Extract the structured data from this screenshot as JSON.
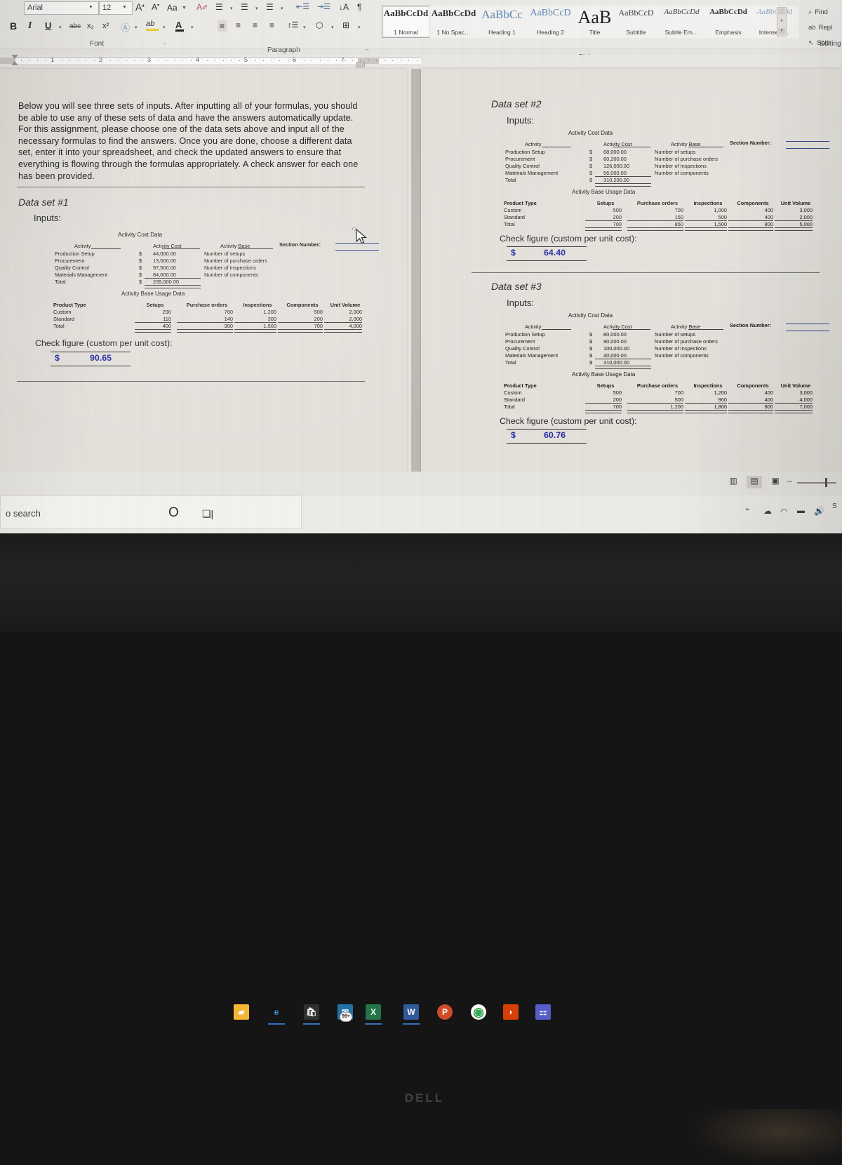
{
  "window": {
    "app": "Microsoft Word",
    "font_name": "Arial",
    "font_size": "12"
  },
  "ribbon": {
    "groups": {
      "font": "Font",
      "paragraph": "Paragraph",
      "styles": "Styles",
      "editing": "Editing"
    },
    "font_buttons": {
      "grow": "A",
      "shrink": "A",
      "change_case": "Aa",
      "clear_formatting": "clear-formatting-icon",
      "bold": "B",
      "italic": "I",
      "underline": "U",
      "strikethrough": "abc",
      "subscript": "x₂",
      "superscript": "x²",
      "text_effects": "A",
      "highlight": "ab",
      "font_color": "A"
    },
    "paragraph_buttons": [
      "bullets-icon",
      "numbering-icon",
      "multilevel-list-icon",
      "decrease-indent-icon",
      "increase-indent-icon",
      "sort-icon",
      "show-marks-icon",
      "align-left-icon",
      "align-center-icon",
      "align-right-icon",
      "justify-icon",
      "line-spacing-icon",
      "shading-icon",
      "borders-icon"
    ],
    "styles": [
      {
        "preview": "AaBbCcDd",
        "name": "1 Normal",
        "size": 13,
        "color": "#2c2c2c",
        "bold": true,
        "selected": true
      },
      {
        "preview": "AaBbCcDd",
        "name": "1 No Spac…",
        "size": 13,
        "color": "#2c2c2c",
        "bold": true,
        "selected": false
      },
      {
        "preview": "AaBbCc",
        "name": "Heading 1",
        "size": 17,
        "color": "#5b86b5",
        "bold": false,
        "selected": false
      },
      {
        "preview": "AaBbCcD",
        "name": "Heading 2",
        "size": 14,
        "color": "#5b86b5",
        "bold": false,
        "selected": false
      },
      {
        "preview": "AaB",
        "name": "Title",
        "size": 26,
        "color": "#1b1b1b",
        "bold": false,
        "selected": false
      },
      {
        "preview": "AaBbCcD",
        "name": "Subtitle",
        "size": 12,
        "color": "#3c3c3c",
        "bold": false,
        "selected": false
      },
      {
        "preview": "AaBbCcDd",
        "name": "Subtle Em…",
        "size": 11,
        "color": "#3c3c3c",
        "bold": false,
        "selected": false
      },
      {
        "preview": "AaBbCcDd",
        "name": "Emphasis",
        "size": 11,
        "color": "#2c2c2c",
        "bold": true,
        "selected": false
      },
      {
        "preview": "AaBbCcDd",
        "name": "Intense E…",
        "size": 11,
        "color": "#8fa8c2",
        "bold": false,
        "selected": false
      }
    ],
    "editing": [
      {
        "icon": "search-icon",
        "label": "Find"
      },
      {
        "icon": "replace-icon",
        "label": "Repl"
      },
      {
        "icon": "select-icon",
        "label": "Sele"
      }
    ]
  },
  "ruler": {
    "ticks": [
      "1",
      "2",
      "3",
      "4",
      "5",
      "6",
      "7"
    ]
  },
  "document": {
    "intro_paragraph": "Below you will see three sets of inputs.  After inputting all of your formulas, you should be able to use any of these sets of data and have the answers automatically update. For this assignment, please choose one of the data sets above and input all of the necessary formulas to find the answers. Once you are done, choose a different data set, enter it into your spreadsheet, and check the updated answers to ensure that everything is flowing through the formulas appropriately. A check answer for each one has been provided.",
    "inputs_label": "Inputs:",
    "section_number_label": "Section Number:",
    "check_figure_label": "Check figure (custom per unit cost):",
    "dollar_sign": "$",
    "cost_table": {
      "title": "Activity Cost Data",
      "columns": [
        "Activity",
        "Activity Cost",
        "Activity Base"
      ],
      "total_label": "Total"
    },
    "usage_table": {
      "title": "Activity Base Usage Data",
      "columns": [
        "Product Type",
        "Setups",
        "Purchase orders",
        "Inspections",
        "Components",
        "Unit Volume"
      ],
      "rows_labels": [
        "Custom",
        "Standard",
        "Total"
      ]
    },
    "data_sets": [
      {
        "title": "Data set #1",
        "cost_rows": [
          {
            "activity": "Production Setup",
            "cost": "44,000.00",
            "base": "Number of setups"
          },
          {
            "activity": "Procurement",
            "cost": "13,500.00",
            "base": "Number of purchase orders"
          },
          {
            "activity": "Quality Control",
            "cost": "97,500.00",
            "base": "Number of Inspections"
          },
          {
            "activity": "Materials Management",
            "cost": "84,000.00",
            "base": "Number of components"
          }
        ],
        "cost_total": "239,000.00",
        "usage_rows": [
          {
            "type": "Custom",
            "setups": "290",
            "purchase_orders": "760",
            "inspections": "1,200",
            "components": "500",
            "unit_volume": "2,000"
          },
          {
            "type": "Standard",
            "setups": "110",
            "purchase_orders": "140",
            "inspections": "300",
            "components": "200",
            "unit_volume": "2,000"
          },
          {
            "type": "Total",
            "setups": "400",
            "purchase_orders": "900",
            "inspections": "1,500",
            "components": "700",
            "unit_volume": "4,000"
          }
        ],
        "check_figure": "90.65"
      },
      {
        "title": "Data set #2",
        "cost_rows": [
          {
            "activity": "Production Setup",
            "cost": "68,000.00",
            "base": "Number of setups"
          },
          {
            "activity": "Procurement",
            "cost": "60,200.00",
            "base": "Number of purchase orders"
          },
          {
            "activity": "Quality Control",
            "cost": "126,000.00",
            "base": "Number of Inspections"
          },
          {
            "activity": "Materials Management",
            "cost": "56,000.00",
            "base": "Number of components"
          }
        ],
        "cost_total": "310,200.00",
        "usage_rows": [
          {
            "type": "Custom",
            "setups": "500",
            "purchase_orders": "700",
            "inspections": "1,000",
            "components": "400",
            "unit_volume": "3,000"
          },
          {
            "type": "Standard",
            "setups": "200",
            "purchase_orders": "150",
            "inspections": "500",
            "components": "400",
            "unit_volume": "2,000"
          },
          {
            "type": "Total",
            "setups": "700",
            "purchase_orders": "850",
            "inspections": "1,500",
            "components": "800",
            "unit_volume": "5,000"
          }
        ],
        "check_figure": "64.40"
      },
      {
        "title": "Data set #3",
        "cost_rows": [
          {
            "activity": "Production Setup",
            "cost": "80,000.00",
            "base": "Number of setups"
          },
          {
            "activity": "Procurement",
            "cost": "90,000.00",
            "base": "Number of purchase orders"
          },
          {
            "activity": "Quality Control",
            "cost": "100,000.00",
            "base": "Number of Inspections"
          },
          {
            "activity": "Materials Management",
            "cost": "40,000.00",
            "base": "Number of components"
          }
        ],
        "cost_total": "310,000.00",
        "usage_rows": [
          {
            "type": "Custom",
            "setups": "500",
            "purchase_orders": "700",
            "inspections": "1,200",
            "components": "400",
            "unit_volume": "3,000"
          },
          {
            "type": "Standard",
            "setups": "200",
            "purchase_orders": "500",
            "inspections": "900",
            "components": "400",
            "unit_volume": "4,000"
          },
          {
            "type": "Total",
            "setups": "700",
            "purchase_orders": "1,200",
            "inspections": "1,800",
            "components": "800",
            "unit_volume": "7,000"
          }
        ],
        "check_figure": "60.76"
      }
    ]
  },
  "status_bar": {
    "view_buttons": [
      "read-mode-icon",
      "print-layout-icon",
      "web-layout-icon"
    ],
    "zoom_minus": "–"
  },
  "taskbar": {
    "search_placeholder": "o search",
    "cortana": "O",
    "task_view": "task-view-icon",
    "apps": [
      {
        "name": "file-explorer-icon",
        "glyph": "",
        "open": false
      },
      {
        "name": "edge-icon",
        "glyph": "",
        "open": true
      },
      {
        "name": "microsoft-store-icon",
        "glyph": "",
        "open": true
      },
      {
        "name": "mail-icon",
        "glyph": "",
        "badge": "99+",
        "open": false
      },
      {
        "name": "excel-icon",
        "glyph": "X",
        "open": true
      },
      {
        "name": "word-icon",
        "glyph": "W",
        "open": true
      },
      {
        "name": "powerpoint-icon",
        "glyph": "P",
        "open": false
      },
      {
        "name": "chrome-icon",
        "glyph": "",
        "open": false
      },
      {
        "name": "office-icon",
        "glyph": "",
        "open": false
      },
      {
        "name": "teams-icon",
        "glyph": "",
        "open": false
      }
    ],
    "tray": [
      "show-hidden-icons-icon",
      "onedrive-icon",
      "cloud-icon",
      "battery-icon",
      "volume-icon"
    ]
  },
  "laptop": {
    "brand": "DELL"
  },
  "colors": {
    "accent_blue": "#2b3f86",
    "check_value": "#1f27a8",
    "number_gold": "#6d5a17",
    "style_heading": "#5b86b5"
  }
}
